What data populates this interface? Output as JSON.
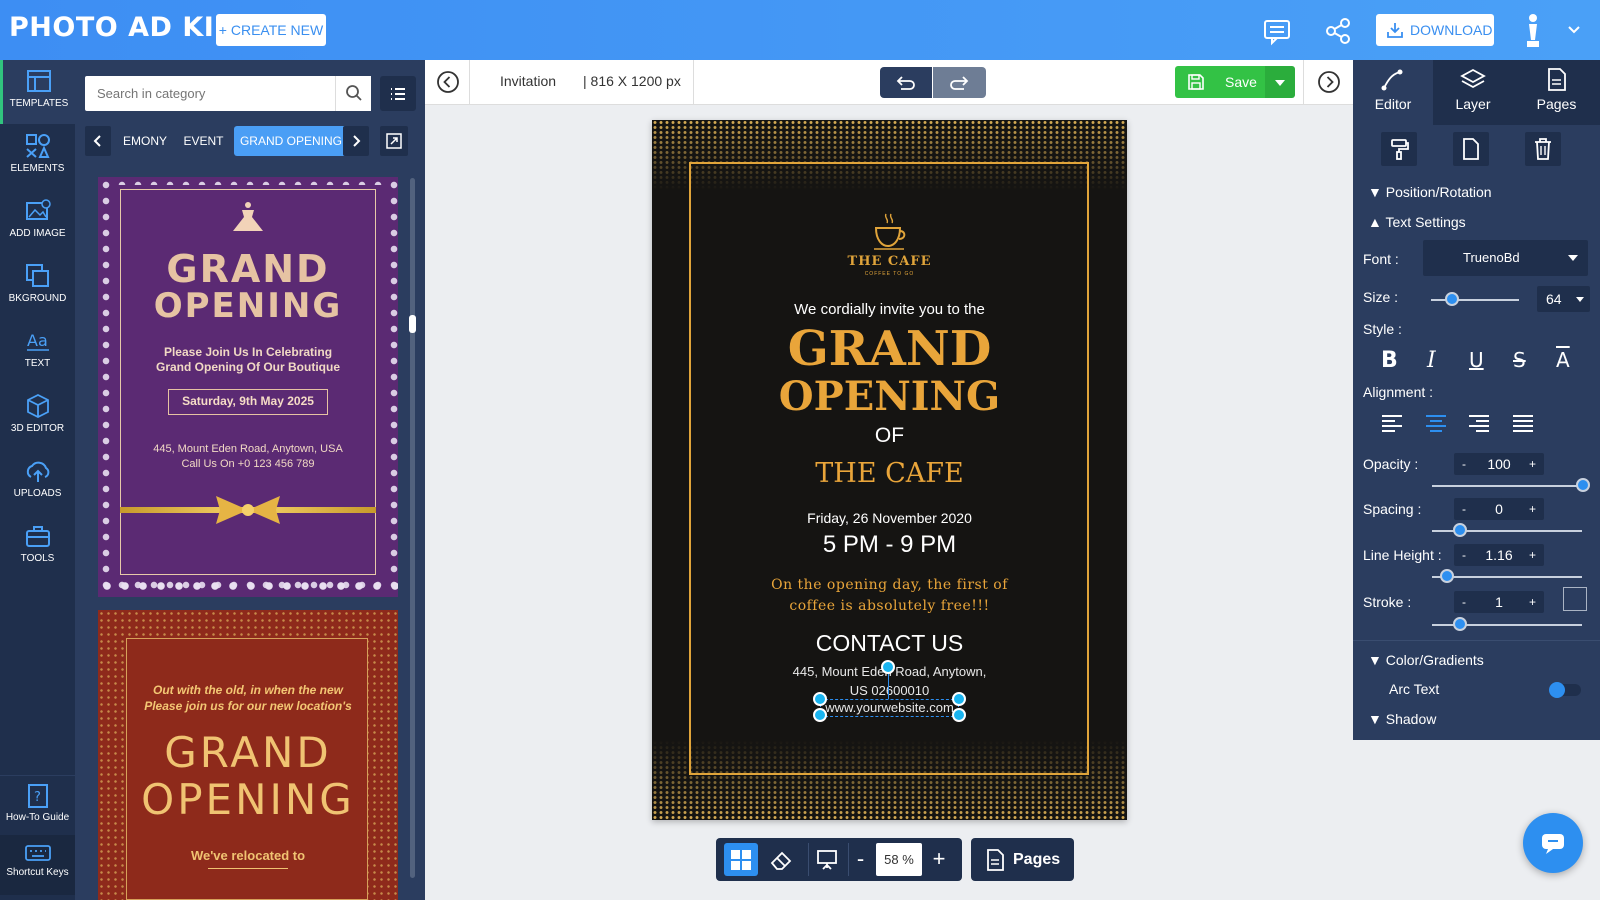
{
  "app": {
    "logo_text": "PHOTO AD KING",
    "create_label": "CREATE NEW",
    "download_label": "DOWNLOAD"
  },
  "rail": {
    "items": [
      {
        "label": "TEMPLATES",
        "icon": "templates-icon"
      },
      {
        "label": "ELEMENTS",
        "icon": "elements-icon"
      },
      {
        "label": "ADD IMAGE",
        "icon": "add-image-icon"
      },
      {
        "label": "BKGROUND",
        "icon": "background-icon"
      },
      {
        "label": "TEXT",
        "icon": "text-icon"
      },
      {
        "label": "3D EDITOR",
        "icon": "cube-icon"
      },
      {
        "label": "UPLOADS",
        "icon": "upload-icon"
      },
      {
        "label": "TOOLS",
        "icon": "toolbox-icon"
      }
    ],
    "howto_label": "How-To Guide",
    "shortcut_label": "Shortcut Keys"
  },
  "panel": {
    "search_placeholder": "Search in category",
    "categories": [
      "EMONY",
      "EVENT",
      "GRAND OPENING"
    ],
    "active_category": "GRAND OPENING"
  },
  "templates": [
    {
      "title_1": "GRAND",
      "title_2": "OPENING",
      "subtitle_1": "Please Join Us In Celebrating",
      "subtitle_2": "Grand Opening Of Our Boutique",
      "date": "Saturday, 9th May 2025",
      "address_1": "445, Mount Eden Road, Anytown, USA",
      "address_2": "Call Us On +0 123 456 789"
    },
    {
      "intro_1": "Out with the old, in when the new",
      "intro_2": "Please join us for our new location's",
      "title_1": "GRAND",
      "title_2": "OPENING",
      "footer": "We've relocated to"
    }
  ],
  "document": {
    "name": "Invitation",
    "size": "| 816 X 1200 px",
    "save_label": "Save"
  },
  "poster": {
    "cafe_name": "THE CAFE",
    "cafe_tag": "COFFEE TO GO",
    "invite": "We cordially invite you to the",
    "grand": "GRAND",
    "opening": "OPENING",
    "of": "OF",
    "the_cafe": "THE CAFE",
    "date": "Friday, 26 November 2020",
    "time": "5 PM - 9 PM",
    "offer_1": "On the opening day, the first of",
    "offer_2": "coffee is absolutely free!!!",
    "contact_title": "CONTACT US",
    "address_1": "445, Mount Eden Road, Anytown,",
    "address_2": "US 02600010",
    "website": "www.yourwebsite.com"
  },
  "bottom": {
    "zoom": "58 %",
    "pages_label": "Pages"
  },
  "right": {
    "tabs": [
      "Editor",
      "Layer",
      "Pages"
    ],
    "sections": {
      "position": "Position/Rotation",
      "text_settings": "Text Settings",
      "color": "Color/Gradients",
      "arc": "Arc Text",
      "shadow": "Shadow"
    },
    "font_label": "Font :",
    "font_value": "TruenoBd",
    "size_label": "Size :",
    "size_value": "64",
    "style_label": "Style :",
    "alignment_label": "Alignment :",
    "opacity_label": "Opacity :",
    "opacity_value": "100",
    "spacing_label": "Spacing :",
    "spacing_value": "0",
    "lineheight_label": "Line Height :",
    "lineheight_value": "1.16",
    "stroke_label": "Stroke :",
    "stroke_value": "1",
    "minus": "-",
    "plus": "+"
  },
  "colors": {
    "accent": "#2d8ff0",
    "gold": "#e9a53a",
    "poster_bg": "#151412",
    "panel": "#2b3d5f",
    "rail": "#1f2f4c",
    "save": "#33c245"
  }
}
